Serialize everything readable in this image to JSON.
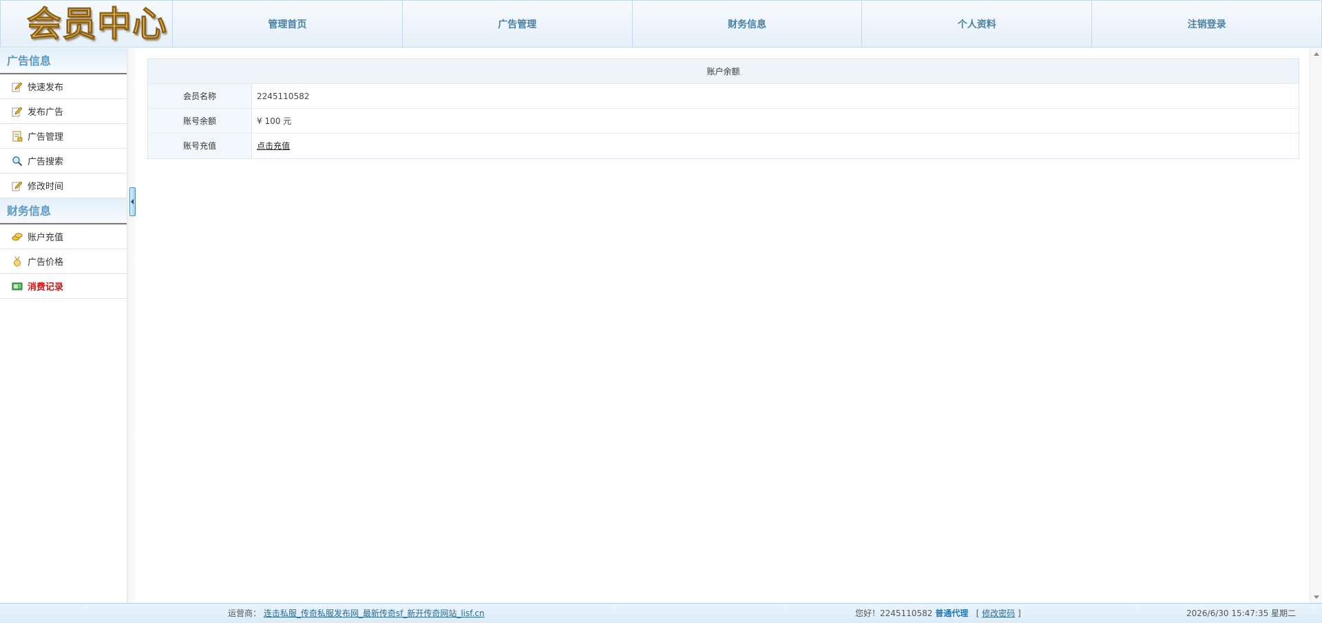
{
  "header": {
    "logo_text": "会员中心",
    "nav": [
      "管理首页",
      "广告管理",
      "财务信息",
      "个人资料",
      "注销登录"
    ]
  },
  "sidebar": {
    "sections": [
      {
        "title": "广告信息",
        "items": [
          {
            "label": "快速发布",
            "icon": "edit-pencil-icon"
          },
          {
            "label": "发布广告",
            "icon": "edit-pencil-icon"
          },
          {
            "label": "广告管理",
            "icon": "document-manage-icon"
          },
          {
            "label": "广告搜索",
            "icon": "magnifier-icon"
          },
          {
            "label": "修改时间",
            "icon": "edit-pencil-icon"
          }
        ]
      },
      {
        "title": "财务信息",
        "items": [
          {
            "label": "账户充值",
            "icon": "coins-icon"
          },
          {
            "label": "广告价格",
            "icon": "medal-icon"
          },
          {
            "label": "消费记录",
            "icon": "money-bill-icon",
            "active": true
          }
        ]
      }
    ]
  },
  "main": {
    "table_title": "账户余额",
    "rows": [
      {
        "label": "会员名称",
        "value": "2245110582"
      },
      {
        "label": "账号余额",
        "value": "¥ 100 元"
      },
      {
        "label": "账号充值",
        "link": "点击充值"
      }
    ]
  },
  "footer": {
    "operator_label": "运营商：",
    "operator_link": "连击私服_传奇私服发布网_最新传奇sf_新开传奇网站_lisf.cn",
    "greeting": "您好！2245110582",
    "role": "普通代理",
    "bracket_open": "[",
    "change_password": "修改密码",
    "bracket_close": "]",
    "datetime": "2026/6/30 15:47:35 星期二"
  },
  "colors": {
    "nav_text": "#4c80a3",
    "section_title": "#5a97c5",
    "active_menu": "#d21414",
    "role_text": "#1d7bbb",
    "footer_bg": "#dbecf8"
  }
}
